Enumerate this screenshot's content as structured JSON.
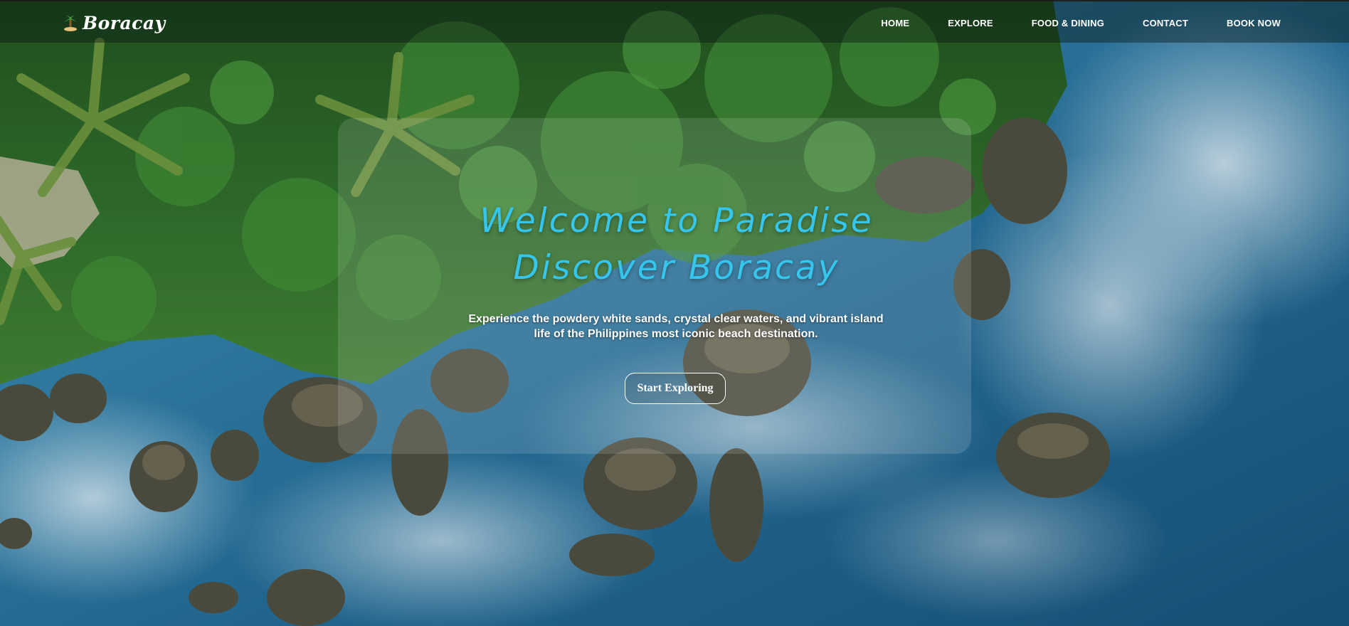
{
  "brand": {
    "logo_text": "Boracay",
    "logo_icon": "palm-island-icon"
  },
  "nav": {
    "items": [
      {
        "label": "HOME"
      },
      {
        "label": "EXPLORE"
      },
      {
        "label": "FOOD & DINING"
      },
      {
        "label": "CONTACT"
      },
      {
        "label": "BOOK NOW"
      }
    ]
  },
  "hero": {
    "headline_line1": "Welcome to Paradise",
    "headline_line2": "Discover Boracay",
    "subtext_line1": "Experience the powdery white sands, crystal clear waters, and vibrant island",
    "subtext_line2": "life of the Philippines most iconic beach destination.",
    "cta_label": "Start Exploring",
    "background": "aerial-coastline-photo"
  },
  "colors": {
    "headline": "#35c6ee",
    "nav_text": "#ffffff",
    "ocean": "#1d5f86",
    "foliage": "#2f6b2a"
  }
}
